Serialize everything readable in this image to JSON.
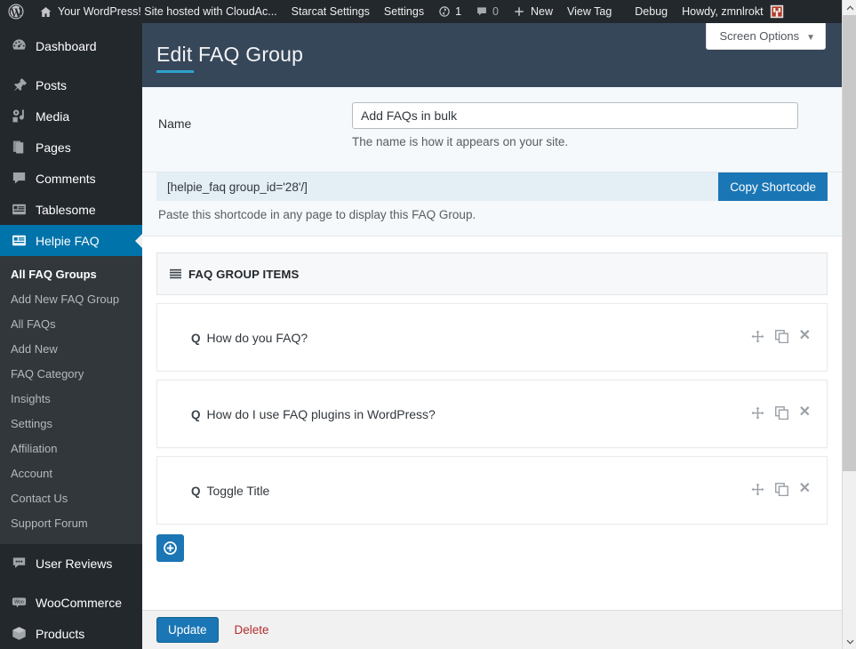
{
  "adminbar": {
    "wp_logo": "wordpress-logo-icon",
    "site_name": "Your WordPress! Site hosted with CloudAc...",
    "items": [
      {
        "label": "Starcat Settings"
      },
      {
        "label": "Settings"
      }
    ],
    "updates_count": "1",
    "comments_count": "0",
    "new_label": "New",
    "view_tag_label": "View Tag",
    "debug_label": "Debug",
    "howdy_label": "Howdy, zmnlrokt"
  },
  "sidebar": {
    "items": [
      {
        "label": "Dashboard",
        "icon": "dashboard-icon",
        "current": false
      },
      {
        "label": "Posts",
        "icon": "pin-icon",
        "current": false
      },
      {
        "label": "Media",
        "icon": "media-icon",
        "current": false
      },
      {
        "label": "Pages",
        "icon": "pages-icon",
        "current": false
      },
      {
        "label": "Comments",
        "icon": "comment-icon",
        "current": false
      },
      {
        "label": "Tablesome",
        "icon": "tablesome-icon",
        "current": false
      },
      {
        "label": "Helpie FAQ",
        "icon": "helpie-faq-icon",
        "current": true
      }
    ],
    "submenu": [
      {
        "label": "All FAQ Groups",
        "current": true
      },
      {
        "label": "Add New FAQ Group",
        "current": false
      },
      {
        "label": "All FAQs",
        "current": false
      },
      {
        "label": "Add New",
        "current": false
      },
      {
        "label": "FAQ Category",
        "current": false
      },
      {
        "label": "Insights",
        "current": false
      },
      {
        "label": "Settings",
        "current": false
      },
      {
        "label": "Affiliation",
        "current": false
      },
      {
        "label": "Account",
        "current": false
      },
      {
        "label": "Contact Us",
        "current": false
      },
      {
        "label": "Support Forum",
        "current": false
      }
    ],
    "items_after": [
      {
        "label": "User Reviews",
        "icon": "user-reviews-icon",
        "current": false
      },
      {
        "label": "WooCommerce",
        "icon": "woocommerce-icon",
        "current": false
      },
      {
        "label": "Products",
        "icon": "products-icon",
        "current": false
      }
    ]
  },
  "page": {
    "title": "Edit FAQ Group",
    "screen_options_label": "Screen Options",
    "screen_options_caret": "▼"
  },
  "name_field": {
    "label": "Name",
    "value": "Add FAQs in bulk",
    "placeholder": "",
    "help": "The name is how it appears on your site."
  },
  "shortcode": {
    "value": "[helpie_faq group_id='28'/]",
    "copy_label": "Copy Shortcode",
    "help": "Paste this shortcode in any page to display this FAQ Group."
  },
  "items_panel": {
    "header": "FAQ GROUP ITEMS",
    "header_icon": "list-lines-icon",
    "q_prefix": "Q",
    "rows": [
      {
        "title": "How do you FAQ?"
      },
      {
        "title": "How do I use FAQ plugins in WordPress?"
      },
      {
        "title": "Toggle Title"
      }
    ],
    "row_actions": {
      "move": "move-icon",
      "duplicate": "duplicate-icon",
      "remove": "close-icon",
      "remove_glyph": "✕"
    },
    "add_button_icon": "add-circle-icon"
  },
  "footer": {
    "update_label": "Update",
    "delete_label": "Delete"
  },
  "scrollbar": {
    "up_glyph": "⌃",
    "down_glyph": "⌄"
  },
  "colors": {
    "admin_bar": "#23282d",
    "sidebar": "#23282d",
    "submenu": "#32373c",
    "current_menu": "#0073aa",
    "page_header": "#37475a",
    "accent_blue": "#1b76b5",
    "title_underline": "#2ea2cc",
    "shortcode_bar": "#e4eef5",
    "delete_red": "#b32d2e"
  }
}
